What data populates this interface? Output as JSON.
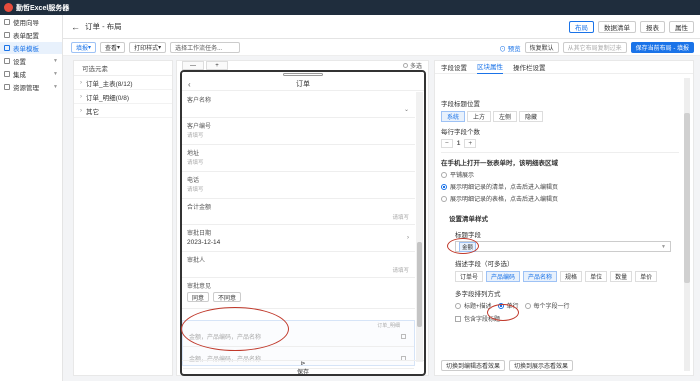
{
  "app": {
    "title": "勤哲Excel服务器"
  },
  "sidebar": {
    "items": [
      {
        "label": "使用向导"
      },
      {
        "label": "表单配置"
      },
      {
        "label": "表单模板"
      },
      {
        "label": "设置"
      },
      {
        "label": "集成"
      },
      {
        "label": "资源管理"
      }
    ]
  },
  "header": {
    "breadcrumb": "订单 - 布局",
    "buttons": [
      "布局",
      "数据清单",
      "报表",
      "属性"
    ]
  },
  "toolbar": {
    "new_label": "填报",
    "view_label": "查看",
    "print_label": "打印样式",
    "select_placeholder": "选择工作流任务...",
    "preview_label": "预览",
    "restore_label": "恢复默认",
    "copy_label": "从其它布局复制过来",
    "save_label": "保存当前布局 - 填报"
  },
  "left_panel": {
    "header": "可选元素",
    "items": [
      "订单_主表(8/12)",
      "订单_明细(0/8)",
      "其它"
    ]
  },
  "phone": {
    "tabs": [
      "—",
      "+"
    ],
    "multi_label": "多选",
    "title": "订单",
    "fields": {
      "customer_name": "客户名称",
      "customer_code": "客户编号",
      "customer_code_ph": "请填写",
      "address": "地址",
      "address_ph": "请填写",
      "phone": "电话",
      "phone_ph": "请填写",
      "total": "合计金额",
      "total_ph": "请填写",
      "approve_date": "审批日期",
      "approve_date_val": "2023-12-14",
      "approver": "审批人",
      "approver_ph": "请填写",
      "opinion": "审批意见",
      "agree": "同意",
      "disagree": "不同意"
    },
    "row_section_tag": "订单_明细",
    "rows": [
      "金额，产品编码，产品名称",
      "金额，产品编码，产品名称"
    ],
    "save_label": "保存"
  },
  "right_panel": {
    "tabs": [
      "字段设置",
      "区块属性",
      "操作栏设置"
    ],
    "title_position_label": "字段标题位置",
    "title_positions": [
      "系统",
      "上方",
      "左侧",
      "隐藏"
    ],
    "per_row_label": "每行字段个数",
    "per_row_value": "1",
    "mobile_label": "在手机上打开一张表单时，该明细表区域",
    "mobile_options": [
      "平铺展示",
      "展示明细记录的清单，点击后进入编辑页",
      "展示明细记录的表格，点击后进入编辑页"
    ],
    "list_style_label": "设置清单样式",
    "title_field_label": "标题字段",
    "title_field_value": "金额",
    "desc_field_label": "描述字段（可多选）",
    "desc_fields": [
      "订单号",
      "产品编码",
      "产品名称",
      "规格",
      "单位",
      "数量",
      "单价"
    ],
    "arrange_label": "多字段排列方式",
    "arrange_options": [
      "标题+描述",
      "单行",
      "每个字段一行"
    ],
    "include_label": "包含字段标题",
    "footer_buttons": [
      "切换到编辑态看效果",
      "切换到展示态看效果"
    ]
  },
  "colors": {
    "accent": "#1a73e8",
    "titlebar": "#1f2d3d",
    "annotation": "#c0392b"
  }
}
